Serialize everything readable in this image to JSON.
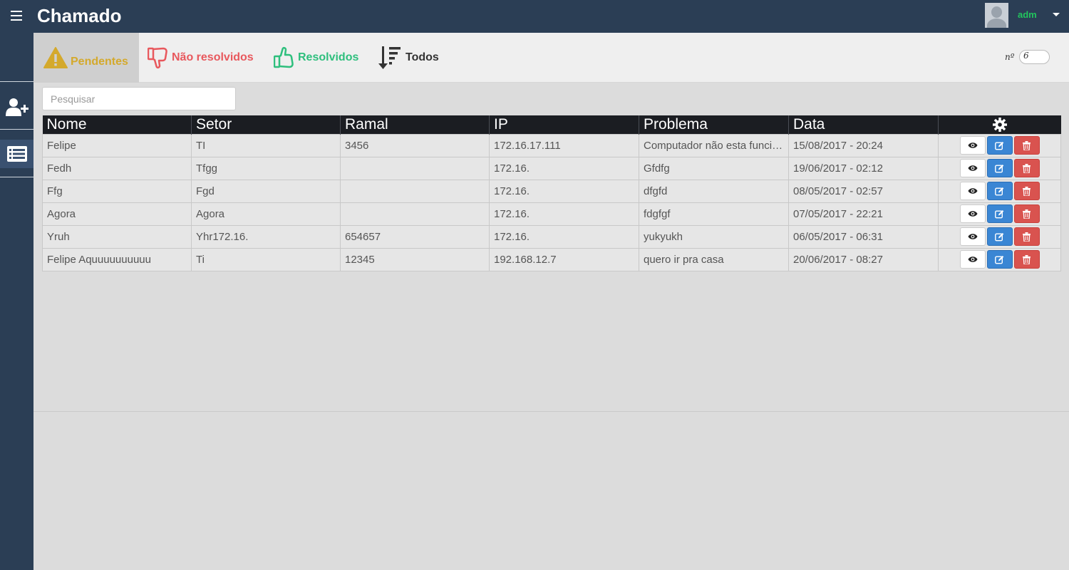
{
  "header": {
    "title": "Chamado",
    "username": "adm"
  },
  "tabs": {
    "pendentes": "Pendentes",
    "nao_resolvidos": "Não resolvidos",
    "resolvidos": "Resolvidos",
    "todos": "Todos"
  },
  "counter": {
    "label": "nº",
    "value": "6"
  },
  "search": {
    "placeholder": "Pesquisar"
  },
  "table": {
    "headers": [
      "Nome",
      "Setor",
      "Ramal",
      "IP",
      "Problema",
      "Data"
    ],
    "rows": [
      [
        "Felipe",
        "TI",
        "3456",
        "172.16.17.111",
        "Computador não esta funcionando",
        "15/08/2017 - 20:24"
      ],
      [
        "Fedh",
        "Tfgg",
        "",
        "172.16.",
        "Gfdfg",
        "19/06/2017 - 02:12"
      ],
      [
        "Ffg",
        "Fgd",
        "",
        "172.16.",
        "dfgfd",
        "08/05/2017 - 02:57"
      ],
      [
        "Agora",
        "Agora",
        "",
        "172.16.",
        "fdgfgf",
        "07/05/2017 - 22:21"
      ],
      [
        "Yruh",
        "Yhr172.16.",
        "654657",
        "172.16.",
        "yukyukh",
        "06/05/2017 - 06:31"
      ],
      [
        "Felipe Aquuuuuuuuuu",
        "Ti",
        "12345",
        "192.168.12.7",
        "quero ir pra casa",
        "20/06/2017 - 08:27"
      ]
    ]
  },
  "colors": {
    "topbar": "#2b3e55",
    "pendentes": "#d4a92c",
    "nao_resolvidos": "#e8585d",
    "resolvidos": "#2ebf7d",
    "username": "#22c55e"
  },
  "icons": {
    "menu": "hamburger-icon",
    "add_user": "user-plus-icon",
    "list": "list-icon",
    "warning": "warning-icon",
    "thumbs_down": "thumbs-down-icon",
    "thumbs_up": "thumbs-up-icon",
    "sort": "sort-icon",
    "settings": "gear-icon",
    "view": "eye-icon",
    "edit": "edit-icon",
    "delete": "trash-icon"
  }
}
